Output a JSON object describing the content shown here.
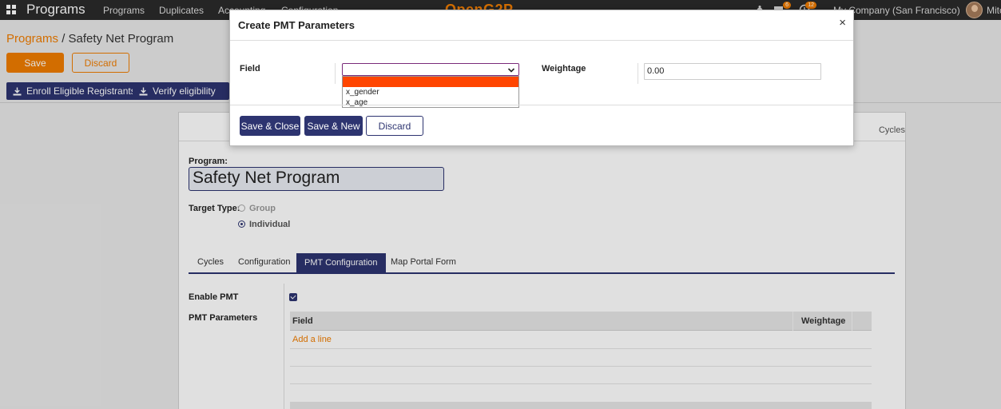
{
  "navbar": {
    "app_name": "Programs",
    "menu": [
      "Programs",
      "Duplicates",
      "Accounting",
      "Configuration"
    ],
    "brand": "OpenG2P",
    "chat_badge": "6",
    "activity_badge": "12",
    "company": "My Company (San Francisco)",
    "user": "Mitc"
  },
  "breadcrumb": {
    "parent": "Programs",
    "separator": " / ",
    "current": "Safety Net Program"
  },
  "control": {
    "save_label": "Save",
    "discard_label": "Discard"
  },
  "header_buttons": [
    "Enroll Eligible Registrants",
    "Verify eligibility"
  ],
  "sheet": {
    "smart_button_label": "Cycles",
    "program_label": "Program:",
    "program_name": "Safety Net Program",
    "target_type_label": "Target Type:",
    "target_options": [
      {
        "label": "Group",
        "checked": false
      },
      {
        "label": "Individual",
        "checked": true
      }
    ],
    "tabs": [
      {
        "label": "Cycles",
        "active": false
      },
      {
        "label": "Configuration",
        "active": false
      },
      {
        "label": "PMT Configuration",
        "active": true
      },
      {
        "label": "Map Portal Form",
        "active": false
      }
    ],
    "enable_pmt_label": "Enable PMT",
    "enable_pmt_checked": true,
    "pmt_parameters_label": "PMT Parameters",
    "table_columns": [
      "Field",
      "Weightage"
    ],
    "add_line_label": "Add a line"
  },
  "modal": {
    "title": "Create PMT Parameters",
    "close_symbol": "×",
    "field_label": "Field",
    "field_value": "",
    "field_options": [
      "",
      "x_gender",
      "x_age"
    ],
    "weightage_label": "Weightage",
    "weightage_value": "0.00",
    "buttons": {
      "save_close": "Save & Close",
      "save_new": "Save & New",
      "discard": "Discard"
    }
  },
  "colors": {
    "navbar": "#2b2b2b",
    "accent_orange": "#f07d00",
    "primary_navy": "#2d3470",
    "option_highlight": "#ff4500"
  }
}
